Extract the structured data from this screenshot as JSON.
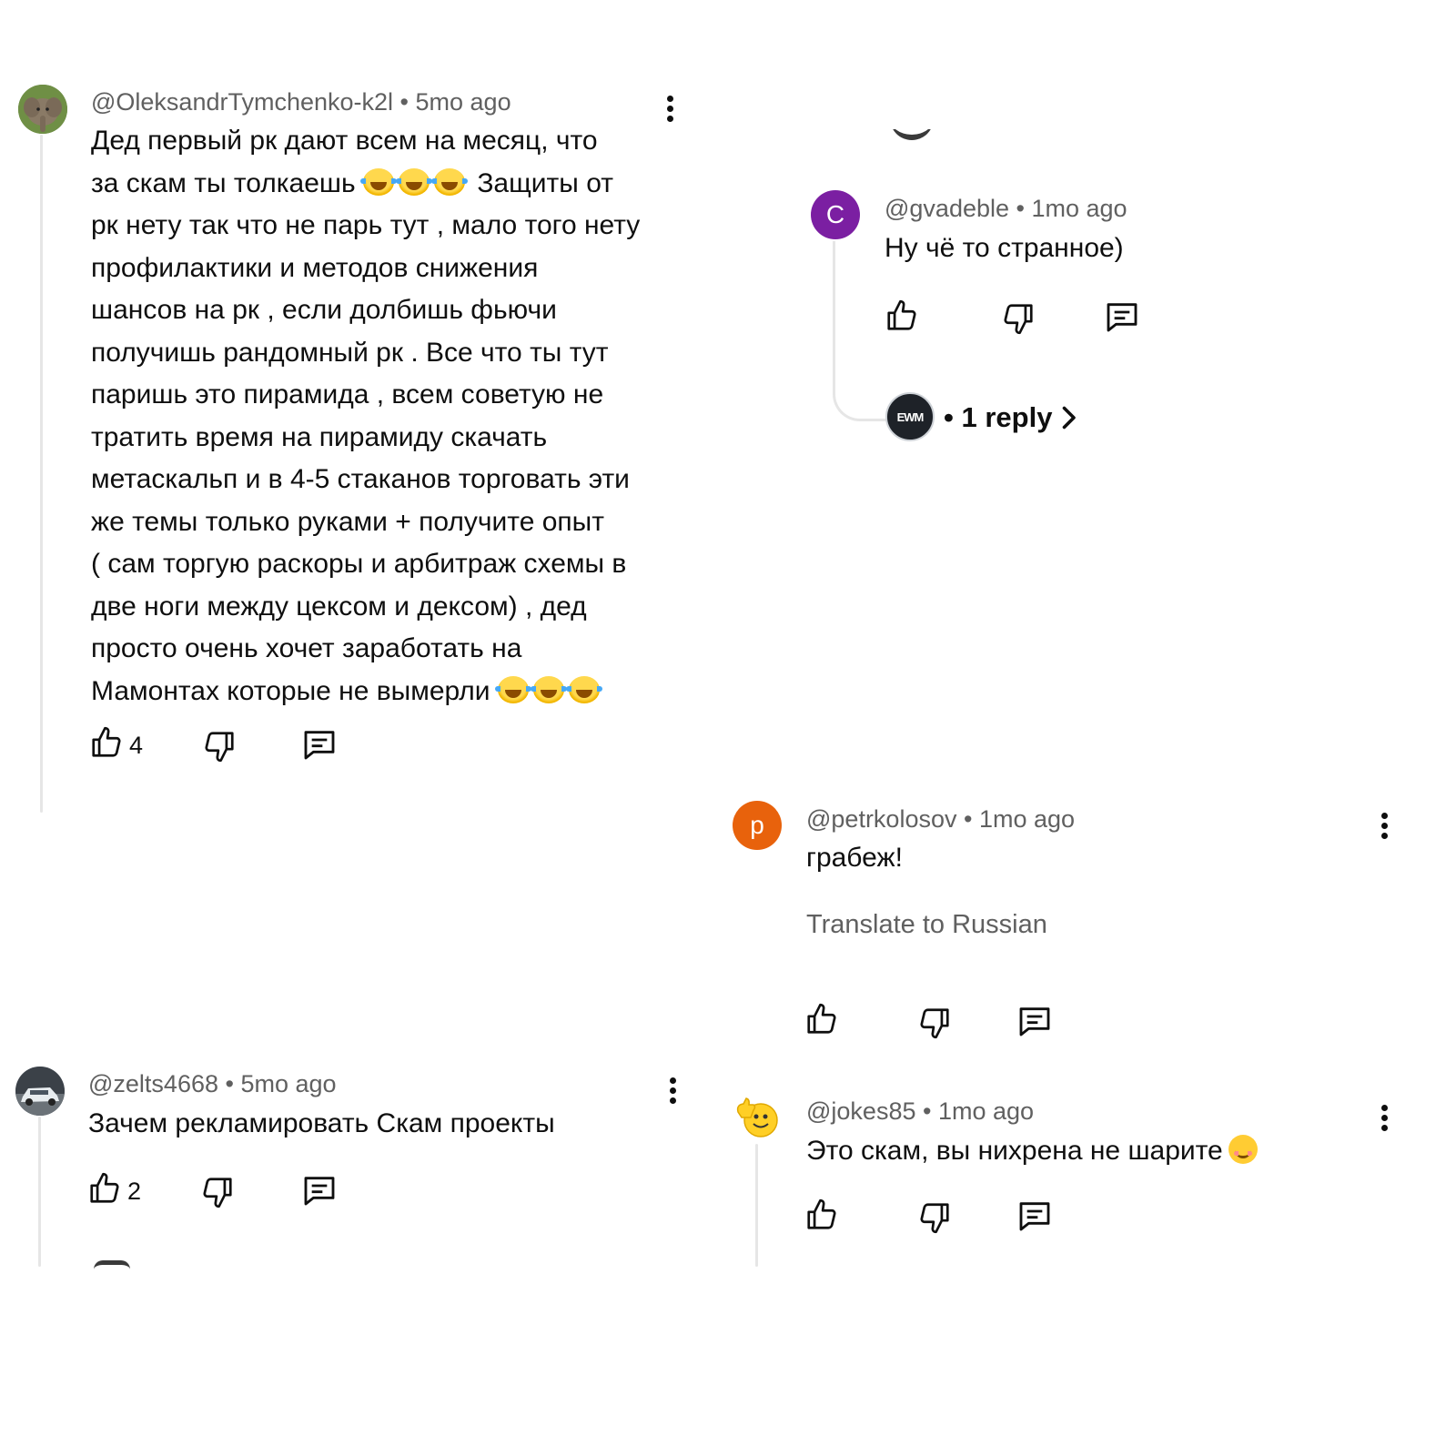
{
  "comments": [
    {
      "author": "@OleksandrTymchenko-k2l",
      "age": "5mo ago",
      "lines": [
        "Дед первый рк дают всем на месяц, что",
        "за скам ты толкаешь",
        "Защиты от",
        "рк нету так что не парь тут , мало того нету",
        "профилактики и методов снижения",
        "шансов на рк , если долбишь фьючи",
        "получишь рандомный рк . Все что ты тут",
        "паришь это пирамида , всем советую не",
        "тратить время на пирамиду скачать",
        "метаскальп и в 4-5 стаканов торговать эти",
        "же темы только руками + получите опыт",
        "( сам торгую раскоры и арбитраж схемы в",
        "две ноги между цексом и дексом) , дед",
        "просто очень хочет заработать на",
        "Мамонтах которые не вымерли"
      ],
      "likes": "4"
    },
    {
      "author": "@gvadeble",
      "age": "1mo ago",
      "avatar_letter": "С",
      "avatar_color": "#7b1fa2",
      "text": "Ну чё то странное)",
      "replies": "1 reply",
      "reply_avatar_text": "ЕWM"
    },
    {
      "author": "@petrkolosov",
      "age": "1mo ago",
      "avatar_letter": "p",
      "avatar_color": "#e8620c",
      "text": "грабеж!",
      "translate": "Translate to Russian"
    },
    {
      "author": "@zelts4668",
      "age": "5mo ago",
      "text": "Зачем рекламировать Скам проекты",
      "likes": "2"
    },
    {
      "author": "@jokes85",
      "age": "1mo ago",
      "text": "Это скам, вы нихрена не шарите"
    }
  ],
  "separator": "•",
  "icons": [
    "like-icon",
    "dislike-icon",
    "reply-icon",
    "more-options-icon",
    "chevron-right-icon"
  ],
  "colors": {
    "text": "#0f0f0f",
    "meta": "#606060",
    "thread_line": "#e6e6e6"
  }
}
